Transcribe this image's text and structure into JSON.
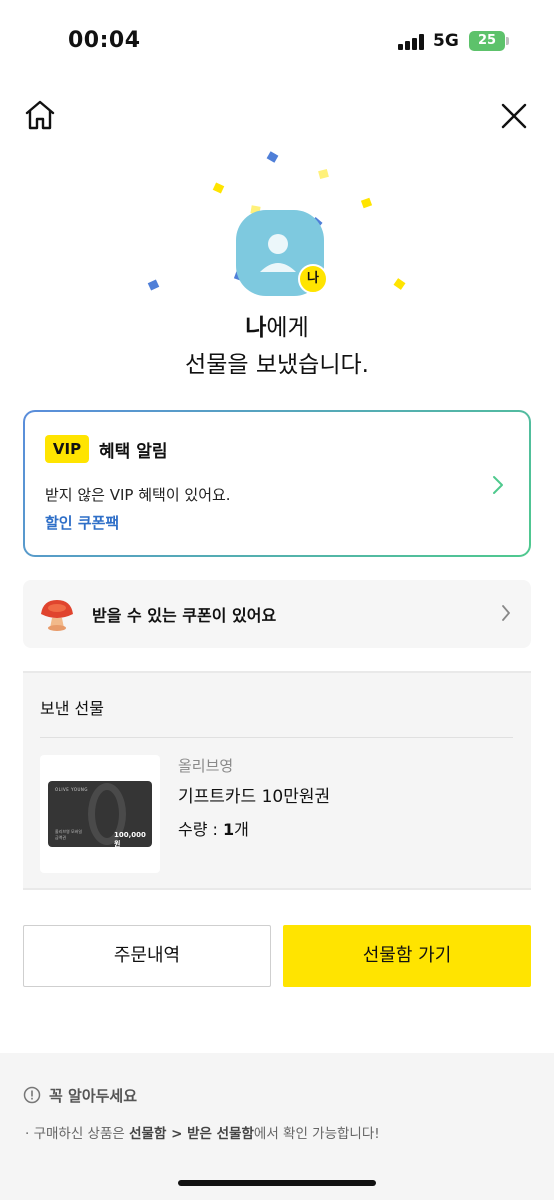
{
  "status_bar": {
    "time": "00:04",
    "network": "5G",
    "battery": "25"
  },
  "nav": {
    "home_icon": "home-icon",
    "close_icon": "close-icon"
  },
  "hero": {
    "badge": "나",
    "recipient": "나",
    "line1_suffix": "에게",
    "line2": "선물을 보냈습니다."
  },
  "vip": {
    "badge": "VIP",
    "title": "혜택 알림",
    "description": "받지 않은 VIP 혜택이 있어요.",
    "link": "할인 쿠폰팩"
  },
  "coupon": {
    "text": "받을 수 있는 쿠폰이 있어요"
  },
  "sent_gift": {
    "title": "보낸 선물",
    "brand": "올리브영",
    "product": "기프트카드 10만원권",
    "qty_label": "수량 : ",
    "qty_value": "1",
    "qty_unit": "개",
    "card": {
      "brand_text": "OLIVE YOUNG",
      "small_text": "올리브영 모바일 금액권",
      "amount": "100,000원"
    }
  },
  "buttons": {
    "orders": "주문내역",
    "giftbox": "선물함 가기"
  },
  "notice": {
    "title": "꼭 알아두세요",
    "bullet": "·",
    "part1": " 구매하신 상품은 ",
    "bold1": "선물함 > 받은 선물함",
    "part2": "에서 확인 가능합니다!"
  },
  "colors": {
    "accent_yellow": "#ffe400",
    "link_blue": "#2f6fc8",
    "avatar": "#7ec9df"
  }
}
